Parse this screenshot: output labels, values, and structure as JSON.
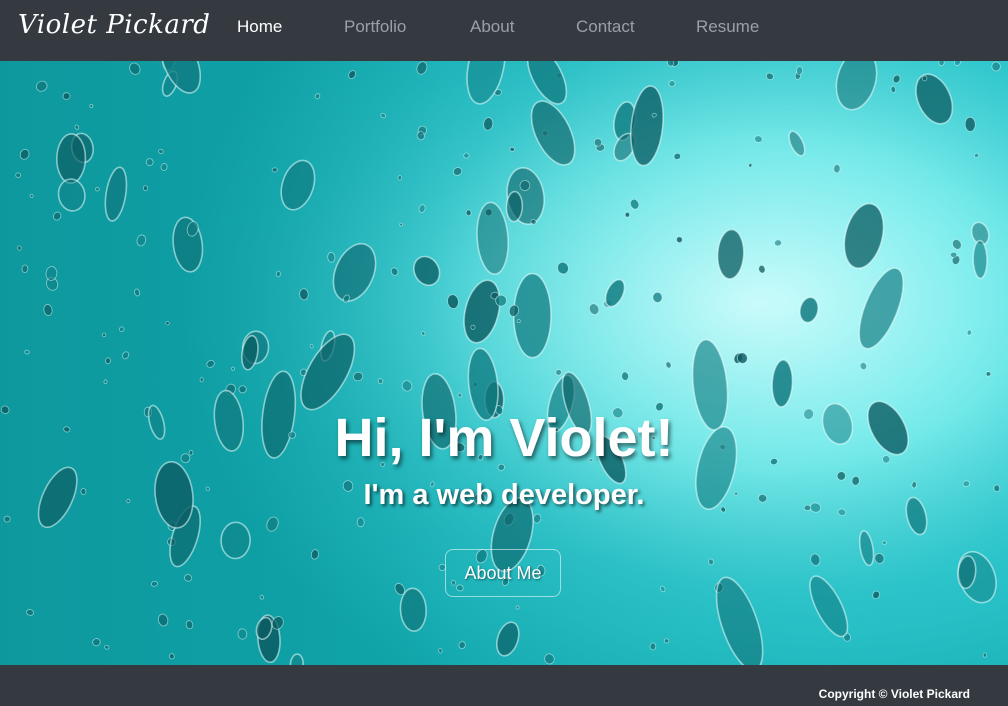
{
  "navbar": {
    "brand": "Violet Pickard",
    "links": [
      {
        "label": "Home",
        "active": true
      },
      {
        "label": "Portfolio",
        "active": false
      },
      {
        "label": "About",
        "active": false
      },
      {
        "label": "Contact",
        "active": false
      },
      {
        "label": "Resume",
        "active": false
      }
    ]
  },
  "hero": {
    "title": "Hi, I'm Violet!",
    "subtitle": "I'm a web developer.",
    "button_label": "About Me",
    "background_image": "water-droplets-on-glass-teal"
  },
  "footer": {
    "copyright": "Copyright © Violet Pickard"
  },
  "colors": {
    "navbar_bg": "#343a40",
    "link_inactive": "#9aa0a6",
    "link_active": "#ffffff",
    "hero_teal": "#2fc9cf"
  }
}
